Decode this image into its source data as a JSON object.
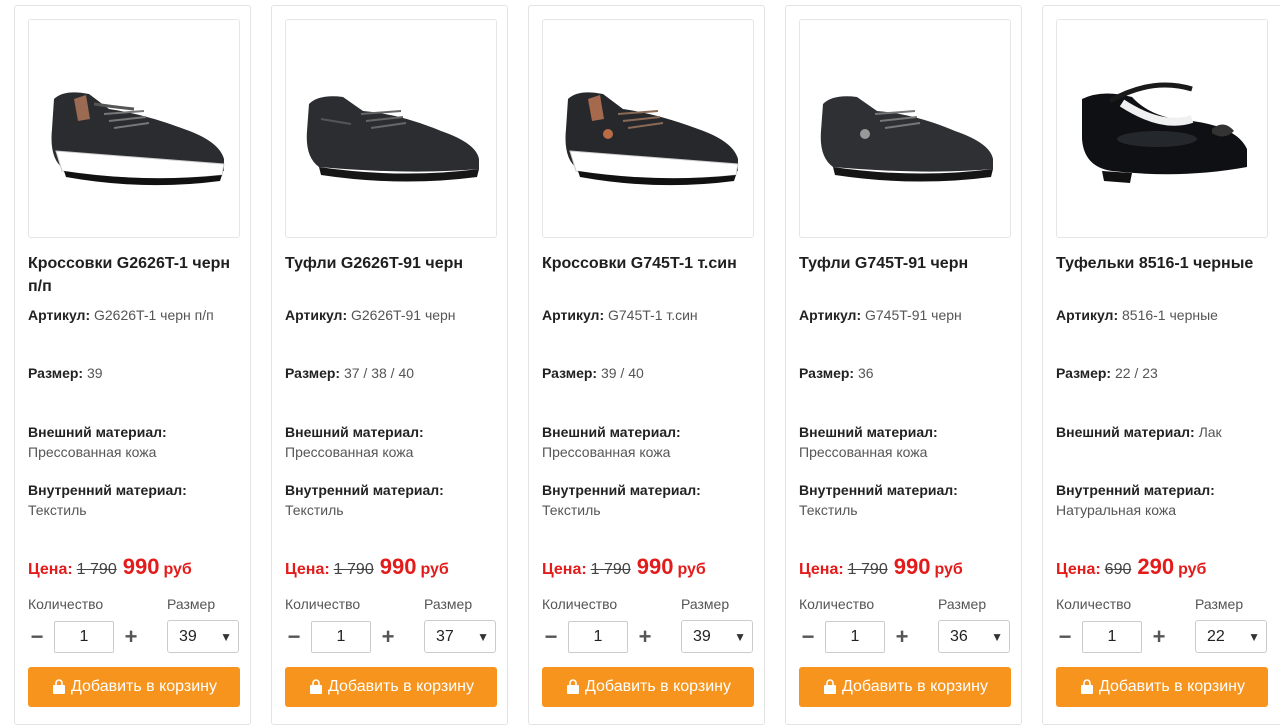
{
  "labels": {
    "article": "Артикул:",
    "size": "Размер:",
    "outer": "Внешний материал:",
    "inner": "Внутренний материал:",
    "price": "Цена:",
    "currency": "руб",
    "quantity": "Количество",
    "size_select": "Размер",
    "add_to_cart": "Добавить в корзину",
    "minus": "−",
    "plus": "+"
  },
  "colors": {
    "accent": "#f7941d",
    "price": "#e41b1b"
  },
  "products": [
    {
      "title": "Кроссовки G2626T-1 черн п/п",
      "article": "G2626T-1 черн п/п",
      "sizes": "39",
      "outer": "Прессованная кожа",
      "inner": "Текстиль",
      "old_price": "1 790",
      "price": "990",
      "quantity": "1",
      "selected_size": "39",
      "image_icon": "sneaker-icon"
    },
    {
      "title": "Туфли G2626T-91 черн",
      "article": "G2626T-91 черн",
      "sizes": "37 / 38 / 40",
      "outer": "Прессованная кожа",
      "inner": "Текстиль",
      "old_price": "1 790",
      "price": "990",
      "quantity": "1",
      "selected_size": "37",
      "image_icon": "shoe-icon"
    },
    {
      "title": "Кроссовки G745T-1 т.син",
      "article": "G745T-1 т.син",
      "sizes": "39 / 40",
      "outer": "Прессованная кожа",
      "inner": "Текстиль",
      "old_price": "1 790",
      "price": "990",
      "quantity": "1",
      "selected_size": "39",
      "image_icon": "sneaker-icon"
    },
    {
      "title": "Туфли G745T-91 черн",
      "article": "G745T-91 черн",
      "sizes": "36",
      "outer": "Прессованная кожа",
      "inner": "Текстиль",
      "old_price": "1 790",
      "price": "990",
      "quantity": "1",
      "selected_size": "36",
      "image_icon": "shoe-icon"
    },
    {
      "title": "Туфельки 8516-1 черные",
      "article": "8516-1 черные",
      "sizes": "22 / 23",
      "outer": "Лак",
      "inner": "Натуральная кожа",
      "old_price": "690",
      "price": "290",
      "quantity": "1",
      "selected_size": "22",
      "image_icon": "girls-shoe-icon"
    }
  ]
}
